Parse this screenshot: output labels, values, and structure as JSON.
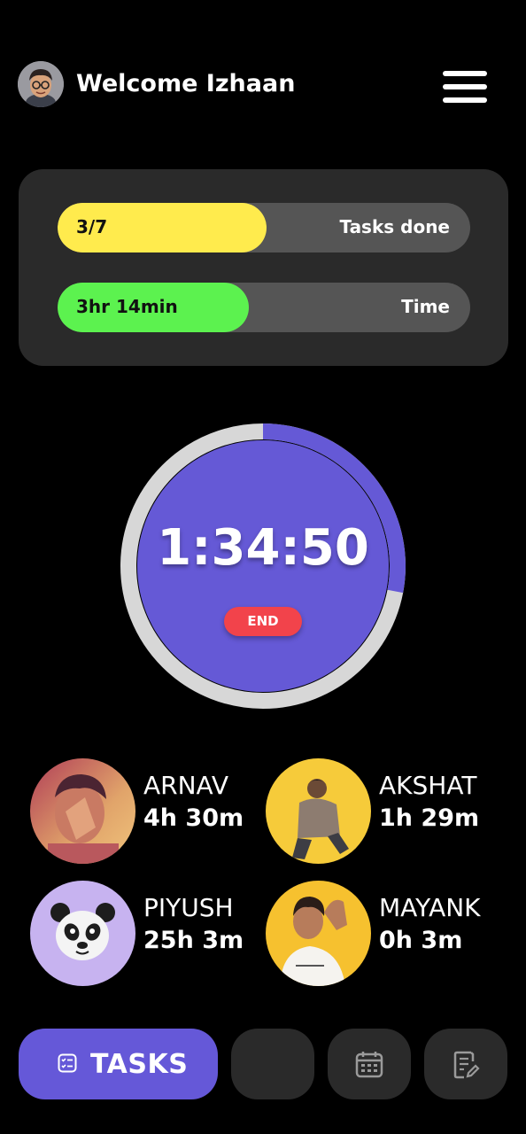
{
  "header": {
    "welcome": "Welcome Izhaan",
    "avatar_icon": "memoji-avatar-icon",
    "menu_icon": "hamburger-menu-icon"
  },
  "stats": {
    "tasks": {
      "value": "3/7",
      "label": "Tasks done",
      "progress": 0.507,
      "color": "#ffeb4d"
    },
    "time": {
      "value": "3hr 14min",
      "label": "Time",
      "progress": 0.464,
      "color": "#5cf24f"
    }
  },
  "timer": {
    "display": "1:34:50",
    "end_label": "END",
    "face_color": "#6559d6",
    "ring_color": "#d7d7d7",
    "ring_progress": 0.72
  },
  "friends": [
    {
      "name": "ARNAV",
      "time": "4h 30m"
    },
    {
      "name": "AKSHAT",
      "time": "1h 29m"
    },
    {
      "name": "PIYUSH",
      "time": "25h 3m"
    },
    {
      "name": "MAYANK",
      "time": "0h 3m"
    }
  ],
  "nav": {
    "tasks_label": "TASKS",
    "tasks_icon": "checklist-icon",
    "calendar_icon": "calendar-icon",
    "notes_icon": "note-edit-icon",
    "accent": "#6558d8"
  }
}
